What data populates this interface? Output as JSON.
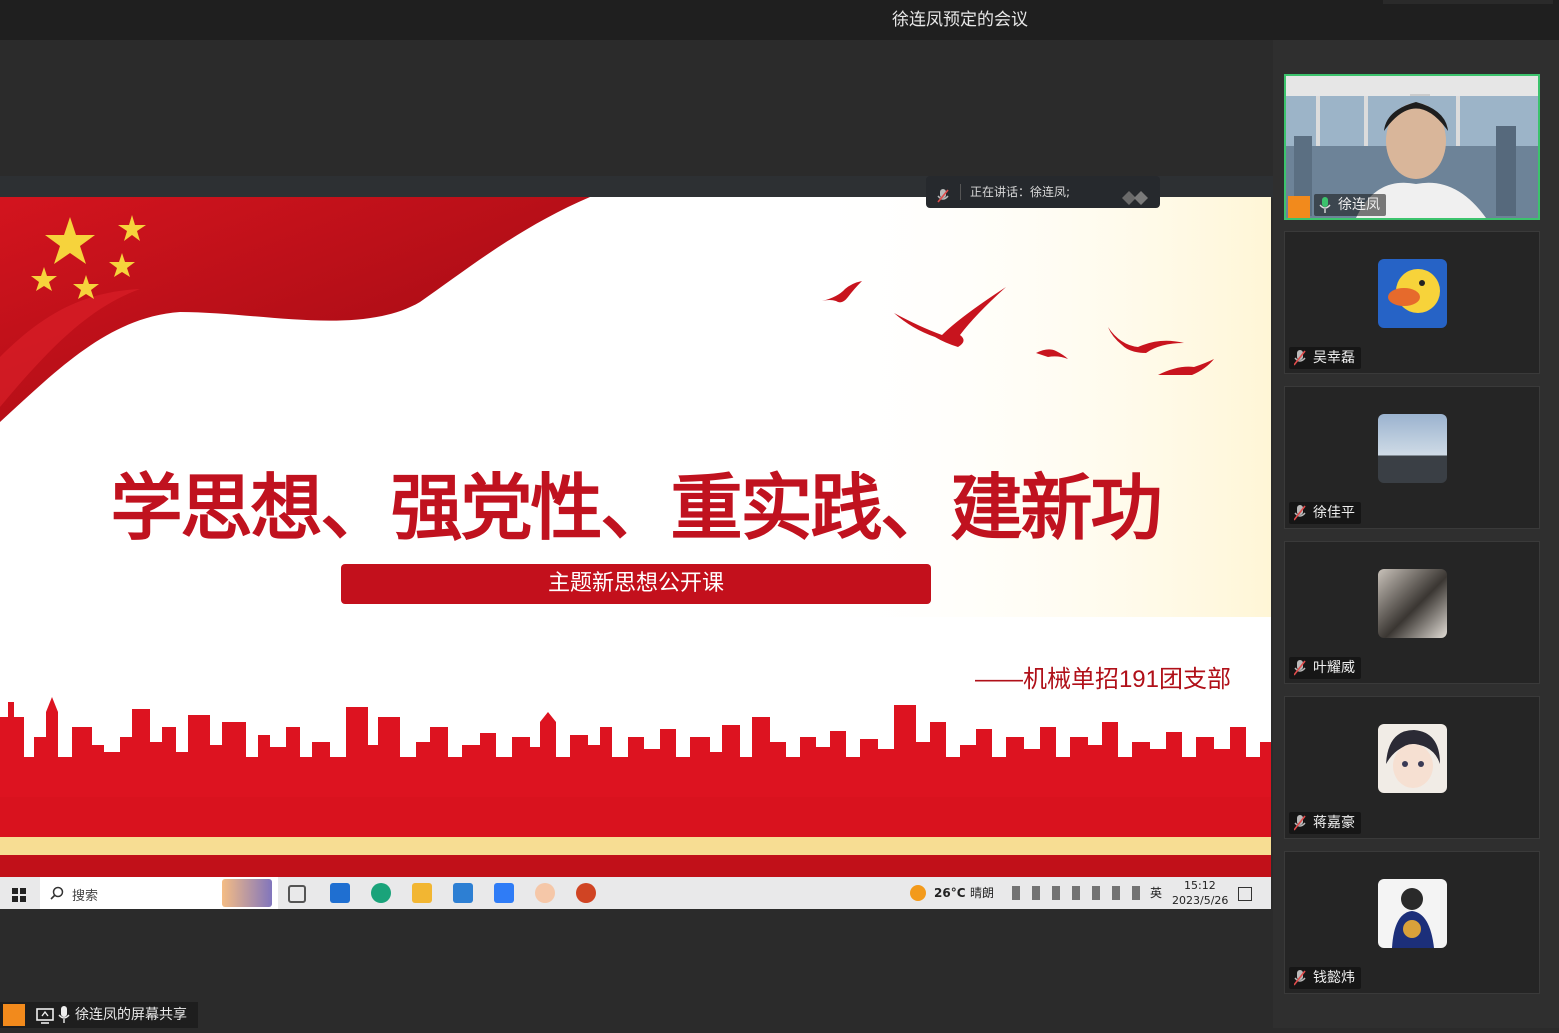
{
  "window": {
    "title": "徐连凤预定的会议"
  },
  "speaking_indicator": {
    "label": "正在讲话：徐连凤;"
  },
  "slide": {
    "headline": "学思想、强党性、重实践、建新功",
    "subtitle": "主题新思想公开课",
    "department": "——机械单招191团支部"
  },
  "taskbar": {
    "search_placeholder": "搜索",
    "weather": "26°C",
    "weather_desc": "晴朗",
    "ime": "英",
    "time": "15:12",
    "date": "2023/5/26"
  },
  "participants": [
    {
      "name": "徐连凤",
      "active": true,
      "mic": "on"
    },
    {
      "name": "吴幸磊",
      "active": false,
      "mic": "muted"
    },
    {
      "name": "徐佳平",
      "active": false,
      "mic": "muted"
    },
    {
      "name": "叶耀威",
      "active": false,
      "mic": "muted"
    },
    {
      "name": "蒋嘉豪",
      "active": false,
      "mic": "muted"
    },
    {
      "name": "钱懿炜",
      "active": false,
      "mic": "muted"
    }
  ],
  "share_status": {
    "label": "徐连凤的屏幕共享"
  },
  "colors": {
    "brand_red": "#c0121f",
    "active_border": "#3cc36d",
    "background": "#2b2b2b"
  }
}
